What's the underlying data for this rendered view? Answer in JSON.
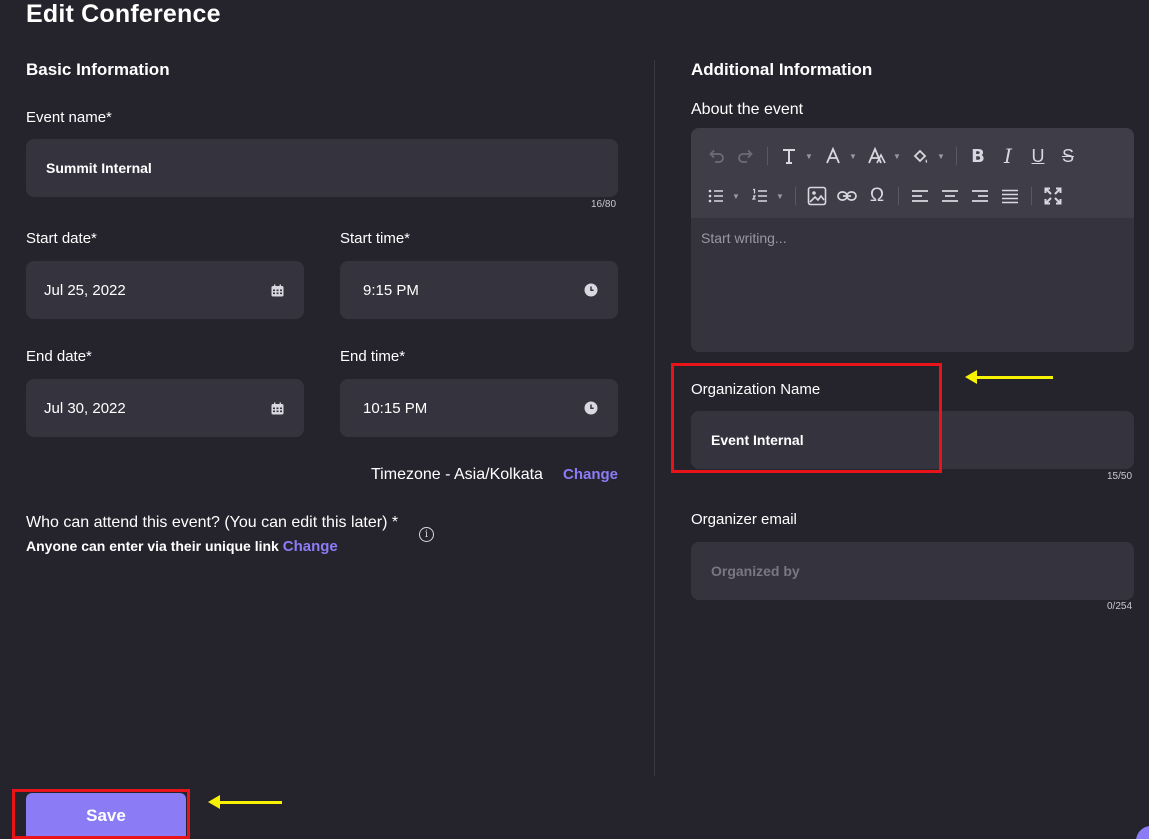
{
  "page": {
    "title": "Edit Conference"
  },
  "basic": {
    "section_title": "Basic Information",
    "event_name": {
      "label": "Event name*",
      "value": "Summit Internal",
      "counter": "16/80"
    },
    "start_date": {
      "label": "Start date*",
      "value": "Jul 25, 2022"
    },
    "start_time": {
      "label": "Start time*",
      "value": "9:15 PM"
    },
    "end_date": {
      "label": "End date*",
      "value": "Jul 30, 2022"
    },
    "end_time": {
      "label": "End time*",
      "value": "10:15 PM"
    },
    "timezone": {
      "text": "Timezone - Asia/Kolkata",
      "link": "Change"
    },
    "attend": {
      "question": "Who can attend this event? (You can edit this later) *",
      "answer": "Anyone can enter via their unique link",
      "link": "Change"
    }
  },
  "additional": {
    "section_title": "Additional Information",
    "about": {
      "label": "About the event",
      "placeholder": "Start writing..."
    },
    "toolbar": {
      "row1": [
        "undo-icon",
        "redo-icon",
        "text-style-icon",
        "font-color-icon",
        "font-size-icon",
        "highlight-icon",
        "bold-icon",
        "italic-icon",
        "underline-icon",
        "strikethrough-icon"
      ],
      "row2": [
        "bullet-list-icon",
        "numbered-list-icon",
        "image-icon",
        "link-icon",
        "special-char-icon",
        "align-left-icon",
        "align-center-icon",
        "align-right-icon",
        "align-justify-icon",
        "fullscreen-icon"
      ]
    },
    "org_name": {
      "label": "Organization Name",
      "value": "Event Internal",
      "counter": "15/50"
    },
    "org_email": {
      "label": "Organizer email",
      "placeholder": "Organized by",
      "counter": "0/254"
    }
  },
  "actions": {
    "save_label": "Save"
  },
  "colors": {
    "background": "#25232c",
    "field": "#35333d",
    "accent": "#8b7cf6",
    "highlight_border": "#e8141a",
    "arrow": "#f7f300"
  }
}
